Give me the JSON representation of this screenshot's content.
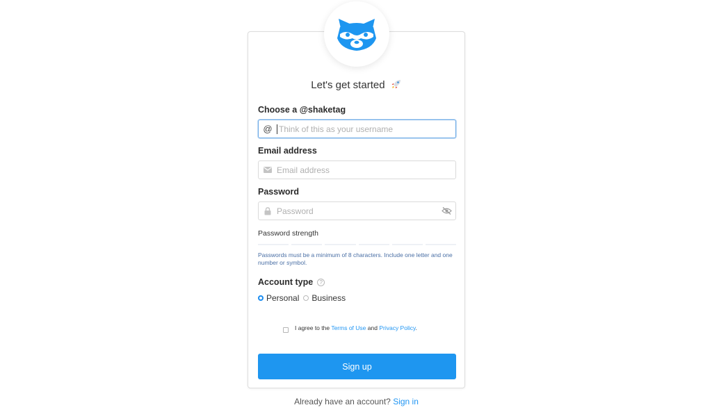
{
  "header": {
    "title": "Let's get started"
  },
  "form": {
    "shaketag_label": "Choose a @shaketag",
    "shaketag_prefix": "@",
    "shaketag_placeholder": "Think of this as your username",
    "email_label": "Email address",
    "email_placeholder": "Email address",
    "password_label": "Password",
    "password_placeholder": "Password",
    "strength_label": "Password strength",
    "strength_segments": 6,
    "password_hint": "Passwords must be a minimum of 8 characters. Include one letter and one number or symbol.",
    "account_type_label": "Account type",
    "account_type_help": "?",
    "account_types": [
      {
        "label": "Personal",
        "selected": true
      },
      {
        "label": "Business",
        "selected": false
      }
    ],
    "agree_prefix": "I agree to the",
    "terms_link": "Terms of Use",
    "agree_and": "and",
    "privacy_link": "Privacy Policy",
    "agree_suffix": ".",
    "agree_checked": false,
    "submit_label": "Sign up"
  },
  "footer": {
    "text": "Already have an account?",
    "signin_link": "Sign in"
  },
  "colors": {
    "primary": "#1e96f0",
    "link": "#2196f3",
    "hint": "#4a6fa5",
    "focus_border": "#6aa8e6"
  },
  "icons": {
    "logo": "raccoon-logo-icon",
    "title_emoji": "rocket-icon",
    "email": "envelope-icon",
    "password": "lock-icon",
    "password_toggle": "eye-slash-icon",
    "help": "question-circle-icon"
  }
}
